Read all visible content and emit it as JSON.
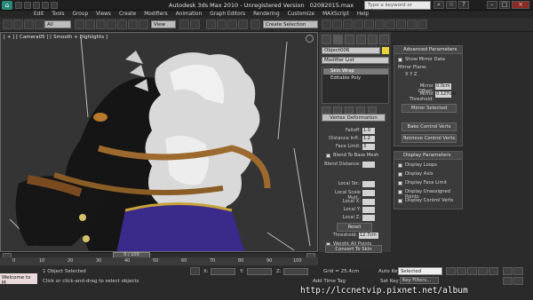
{
  "title_bar": {
    "app_title": "Autodesk 3ds Max  2010  - Unregistered Version",
    "file_name": "02082015.max",
    "search_placeholder": "Type a keyword or phrase"
  },
  "menu": [
    "Edit",
    "Tools",
    "Group",
    "Views",
    "Create",
    "Modifiers",
    "Animation",
    "Graph Editors",
    "Rendering",
    "Customize",
    "MAXScript",
    "Help"
  ],
  "toolbar": {
    "filter_dropdown": "All",
    "coord_dropdown": "View",
    "named_selection": "Create Selection Set"
  },
  "viewport": {
    "label": "[ + ] [ Camera05 ] [ Smooth + Highlights ]"
  },
  "command_panel": {
    "object_name": "Object006",
    "modifier_list": "Modifier List",
    "stack_items": [
      "Skin Wrap",
      "Editable Poly"
    ],
    "rollout_title": "Vertex Deformation",
    "rows": [
      {
        "label": "Falloff:",
        "value": "1.0"
      },
      {
        "label": "Distance Infl.:",
        "value": "1.2"
      },
      {
        "label": "Face Limit:",
        "value": "3"
      }
    ],
    "blend_to_base": "Blend To Base Mesh",
    "blend_distance_label": "Blend Distance:",
    "scale_rows": [
      {
        "label": "Local Str.:"
      },
      {
        "label": "Local Scale Mult.:"
      },
      {
        "label": "Local X:"
      },
      {
        "label": "Local Y:"
      },
      {
        "label": "Local Z:"
      }
    ],
    "reset_button": "Reset",
    "threshold_label": "Threshold:",
    "threshold_value": "12.7cm",
    "weight_all_points": "Weight All Points",
    "convert_button": "Convert To Skin"
  },
  "advanced_panel": {
    "header": "Advanced Parameters",
    "show_mirror_data": "Show Mirror Data",
    "mirror_plane_label": "Mirror Plane:",
    "mirror_plane_axes": "X    Y    Z",
    "mirror_offset_label": "Mirror Offset:",
    "mirror_offset_value": "0.0cm",
    "mirror_threshold_label": "Mirror Threshold:",
    "mirror_threshold_value": "0.127cm",
    "mirror_selected": "Mirror Selected",
    "bake_control_verts": "Bake Control Verts",
    "retrieve_control_verts": "Retrieve Control Verts"
  },
  "display_panel": {
    "header": "Display Parameters",
    "options": [
      "Display Loops",
      "Display Axis",
      "Display Face Limit",
      "Display Unassigned Points",
      "Display Control Verts"
    ]
  },
  "timeline": {
    "frame_indicator": "0 / 100",
    "ticks": [
      "0",
      "10",
      "20",
      "30",
      "40",
      "50",
      "60",
      "70",
      "80",
      "90",
      "100"
    ]
  },
  "status": {
    "maxscript_listener": "Welcome to M",
    "selection": "1 Object Selected",
    "prompt": "Click or click-and-drag to select objects",
    "x_label": "X:",
    "y_label": "Y:",
    "z_label": "Z:",
    "grid": "Grid = 25.4cm",
    "add_time_tag": "Add Time Tag",
    "auto_key": "Auto Key",
    "selected_dropdown": "Selected",
    "set_key": "Set Key",
    "key_filters": "Key Filters..."
  },
  "watermark": "http://lccnetvip.pixnet.net/album"
}
